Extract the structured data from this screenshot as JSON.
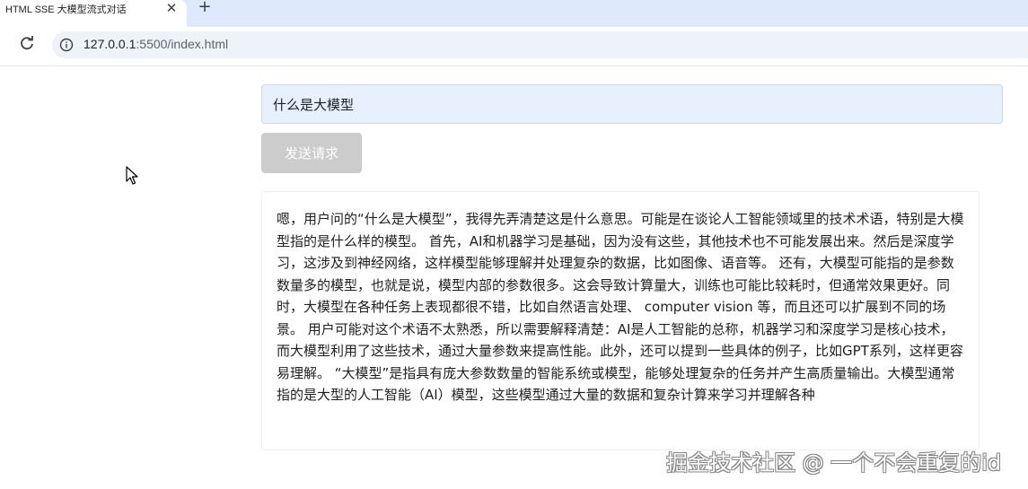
{
  "browser": {
    "tab_title": "HTML SSE 大模型流式对话",
    "tab_close_glyph": "✕",
    "new_tab_glyph": "+",
    "url_host": "127.0.0.1",
    "url_rest": ":5500/index.html",
    "icons": {
      "reload": "reload-icon",
      "info": "info-icon"
    }
  },
  "form": {
    "input_value": "什么是大模型",
    "send_label": "发送请求"
  },
  "response": {
    "text": "嗯，用户问的“什么是大模型”，我得先弄清楚这是什么意思。可能是在谈论人工智能领域里的技术术语，特别是大模型指的是什么样的模型。 首先，AI和机器学习是基础，因为没有这些，其他技术也不可能发展出来。然后是深度学习，这涉及到神经网络，这样模型能够理解并处理复杂的数据，比如图像、语音等。 还有，大模型可能指的是参数数量多的模型，也就是说，模型内部的参数很多。这会导致计算量大，训练也可能比较耗时，但通常效果更好。同时，大模型在各种任务上表现都很不错，比如自然语言处理、 computer vision 等，而且还可以扩展到不同的场景。 用户可能对这个术语不太熟悉，所以需要解释清楚：AI是人工智能的总称，机器学习和深度学习是核心技术，而大模型利用了这些技术，通过大量参数来提高性能。此外，还可以提到一些具体的例子，比如GPT系列，这样更容易理解。 “大模型”是指具有庞大参数数量的智能系统或模型，能够处理复杂的任务并产生高质量输出。大模型通常指的是大型的人工智能（AI）模型，这些模型通过大量的数据和复杂计算来学习并理解各种"
  },
  "watermark": "掘金技术社区 @ 一个不会重复的id"
}
